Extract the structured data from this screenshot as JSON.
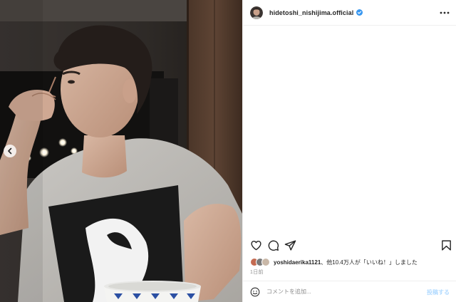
{
  "post": {
    "username": "hidetoshi_nishijima.official",
    "verified": true,
    "likes": {
      "first_liker": "yoshidaerika1121",
      "rest_text": "、他10.4万人が「いいね！」しました"
    },
    "timestamp": "1日前"
  },
  "comment": {
    "placeholder": "コメントを追加...",
    "post_label": "投稿する"
  },
  "colors": {
    "verified_blue": "#3897f0",
    "post_button_disabled": "#b3dbff",
    "secondary_text": "#8e8e8e",
    "divider": "#efefef"
  },
  "icons": {
    "header": [
      "avatar",
      "verified-badge-icon",
      "more-options-icon"
    ],
    "actions": [
      "heart-icon",
      "comment-icon",
      "share-icon",
      "bookmark-icon"
    ],
    "photo": [
      "carousel-prev-icon"
    ],
    "comment": [
      "emoji-icon"
    ]
  }
}
